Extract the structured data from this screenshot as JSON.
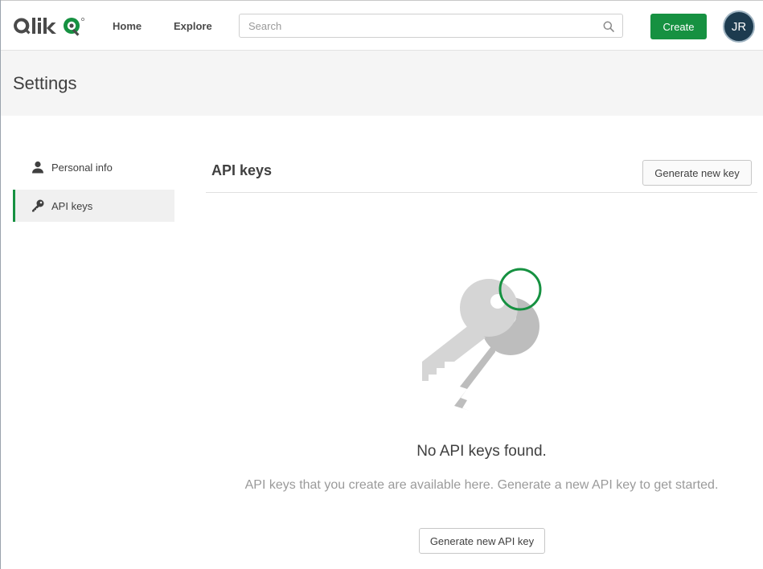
{
  "header": {
    "logo_text": "Qlik",
    "nav": {
      "home": "Home",
      "explore": "Explore"
    },
    "search": {
      "placeholder": "Search",
      "value": ""
    },
    "create_label": "Create",
    "avatar_initials": "JR"
  },
  "page": {
    "title": "Settings"
  },
  "sidebar": {
    "items": [
      {
        "label": "Personal info",
        "icon": "person-icon",
        "active": false
      },
      {
        "label": "API keys",
        "icon": "key-icon",
        "active": true
      }
    ]
  },
  "main": {
    "section_title": "API keys",
    "generate_key_label": "Generate new key",
    "empty_state": {
      "title": "No API keys found.",
      "description": "API keys that you create are available here. Generate a new API key to get started.",
      "button_label": "Generate new API key",
      "illustration": "keys-illustration"
    }
  },
  "colors": {
    "accent": "#169141",
    "avatar_bg": "#1d3b4f",
    "title_band_bg": "#f5f5f5",
    "muted_text": "#9a9a9a"
  }
}
